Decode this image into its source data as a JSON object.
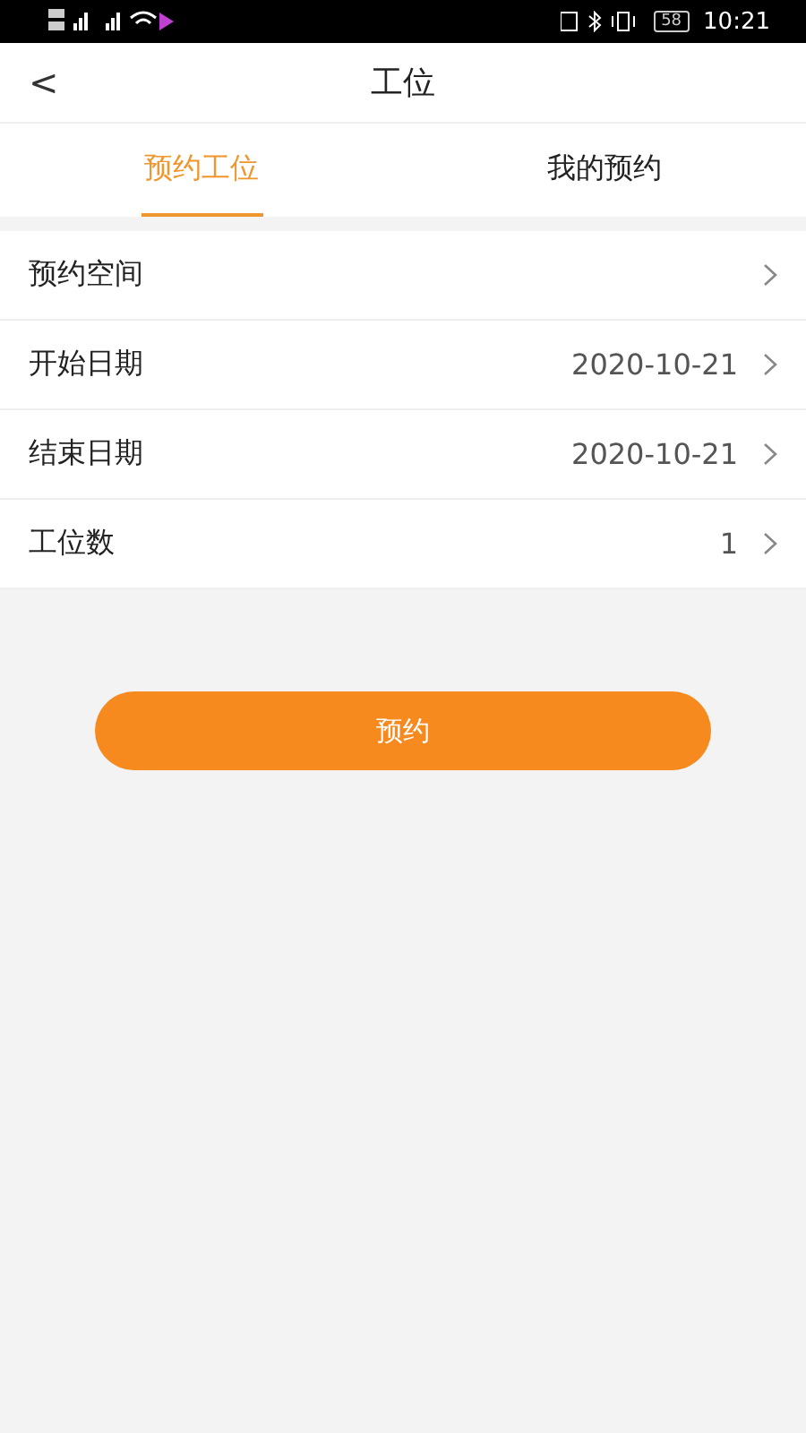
{
  "status_bar": {
    "battery": "58",
    "time": "10:21"
  },
  "nav": {
    "back": "<",
    "title": "工位"
  },
  "tabs": [
    {
      "label": "预约工位",
      "selected": true
    },
    {
      "label": "我的预约",
      "selected": false
    }
  ],
  "rows": [
    {
      "label": "预约空间"
    },
    {
      "label": "开始日期",
      "value": "2020-10-21"
    },
    {
      "label": "结束日期",
      "value": "2020-10-21"
    },
    {
      "label": "工位数",
      "value": "1"
    }
  ],
  "button": "预约"
}
